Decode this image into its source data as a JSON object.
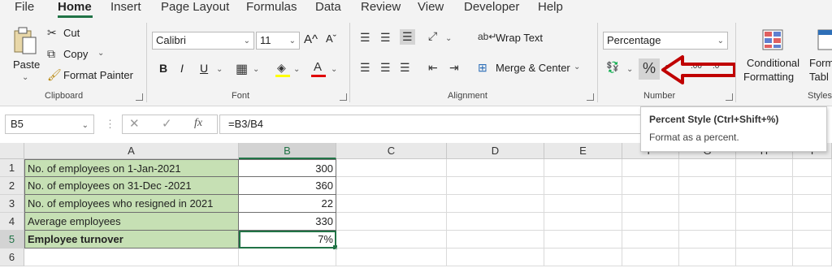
{
  "tabs": [
    "File",
    "Home",
    "Insert",
    "Page Layout",
    "Formulas",
    "Data",
    "Review",
    "View",
    "Developer",
    "Help"
  ],
  "clipboard": {
    "paste": "Paste",
    "cut": "Cut",
    "copy": "Copy",
    "format_painter": "Format Painter",
    "label": "Clipboard"
  },
  "font": {
    "name": "Calibri",
    "size": "11",
    "bold": "B",
    "italic": "I",
    "underline": "U",
    "grow": "A^",
    "shrink": "Aˇ",
    "label": "Font"
  },
  "alignment": {
    "wrap_text": "Wrap Text",
    "merge_center": "Merge & Center",
    "label": "Alignment"
  },
  "number": {
    "format": "Percentage",
    "percent_symbol": "%",
    "label": "Number"
  },
  "styles": {
    "conditional_line1": "Conditional",
    "conditional_line2": "Formatting",
    "format_table_line1": "Form",
    "format_table_line2": "Tabl",
    "label": "Styles"
  },
  "formula_bar": {
    "name_box": "B5",
    "fx": "fx",
    "formula": "=B3/B4"
  },
  "tooltip": {
    "title": "Percent Style (Ctrl+Shift+%)",
    "description": "Format as a percent."
  },
  "columns": [
    "A",
    "B",
    "C",
    "D",
    "E",
    "F",
    "G",
    "H",
    "I"
  ],
  "rows": [
    {
      "num": "1",
      "label": "No. of employees on 1-Jan-2021",
      "value": "300"
    },
    {
      "num": "2",
      "label": "No. of employees on 31-Dec -2021",
      "value": "360"
    },
    {
      "num": "3",
      "label": "No. of employees who resigned in 2021",
      "value": "22"
    },
    {
      "num": "4",
      "label": "Average employees",
      "value": "330"
    },
    {
      "num": "5",
      "label": "Employee turnover",
      "value": "7%"
    },
    {
      "num": "6",
      "label": "",
      "value": ""
    }
  ],
  "colors": {
    "accent": "#217346",
    "label_fill": "#c6e0b4",
    "arrow": "#c00000"
  }
}
